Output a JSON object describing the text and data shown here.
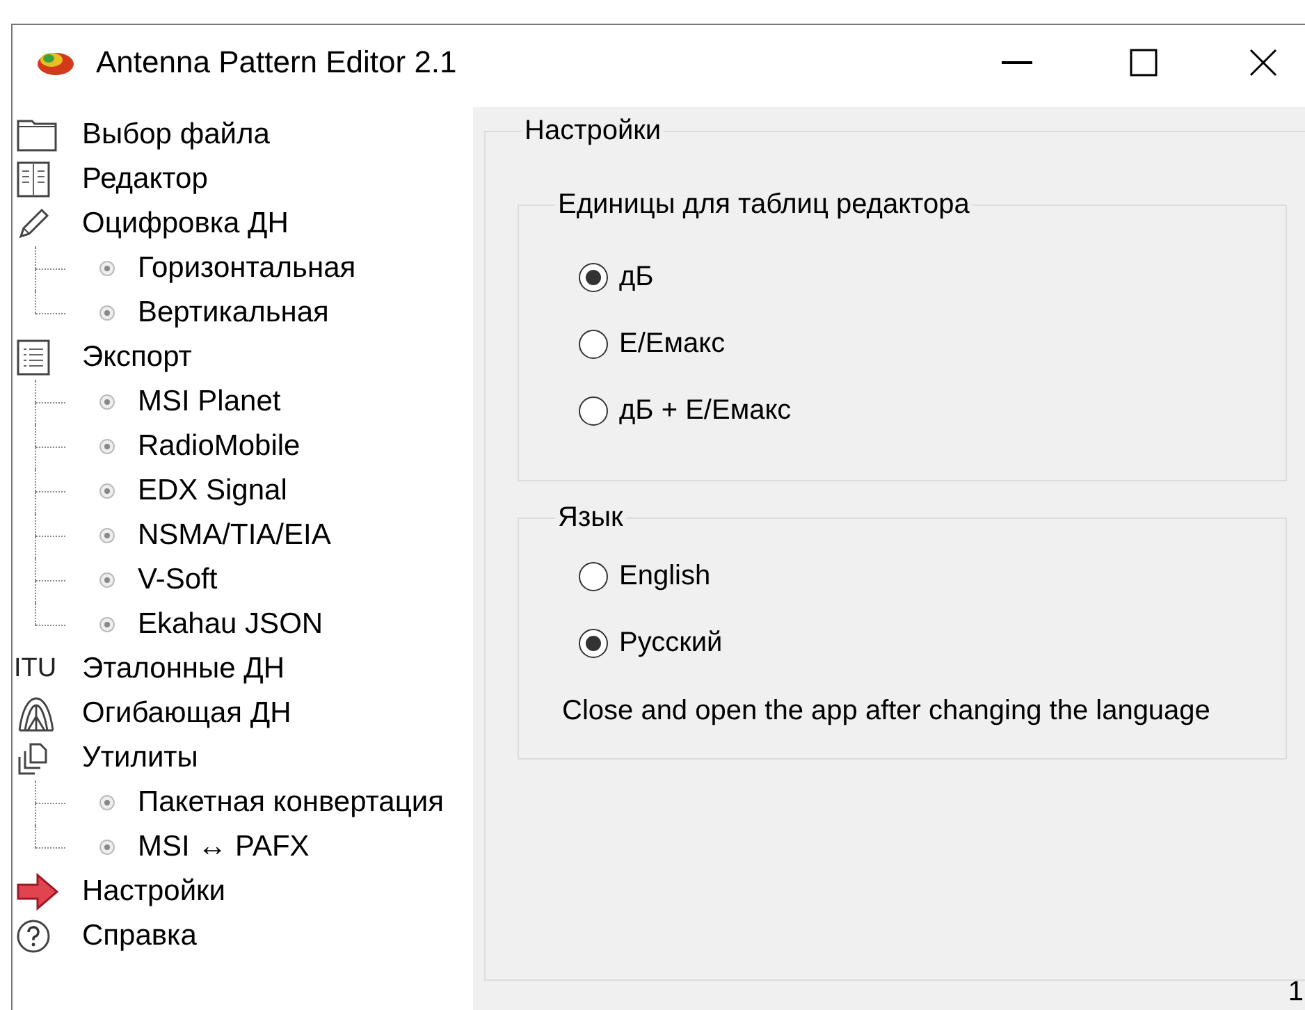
{
  "window": {
    "title": "Antenna Pattern Editor 2.1"
  },
  "sidebar": {
    "items": [
      {
        "kind": "folder",
        "label": "Выбор файла"
      },
      {
        "kind": "book",
        "label": "Редактор"
      },
      {
        "kind": "pencil",
        "label": "Оцифровка ДН",
        "children": [
          {
            "label": "Горизонтальная"
          },
          {
            "label": "Вертикальная"
          }
        ]
      },
      {
        "kind": "list",
        "label": "Экспорт",
        "children": [
          {
            "label": "MSI Planet"
          },
          {
            "label": "RadioMobile"
          },
          {
            "label": "EDX Signal"
          },
          {
            "label": "NSMA/TIA/EIA"
          },
          {
            "label": "V-Soft"
          },
          {
            "label": "Ekahau JSON"
          }
        ]
      },
      {
        "kind": "text",
        "icon_text": "ITU",
        "label": "Эталонные ДН"
      },
      {
        "kind": "envelope",
        "label": "Огибающая ДН"
      },
      {
        "kind": "utilities",
        "label": "Утилиты",
        "children": [
          {
            "label": "Пакетная конвертация"
          },
          {
            "label": "MSI ↔ PAFX"
          }
        ]
      },
      {
        "kind": "arrow",
        "label": "Настройки"
      },
      {
        "kind": "help",
        "label": "Справка"
      }
    ]
  },
  "settings": {
    "title": "Настройки",
    "groups": [
      {
        "title": "Единицы для таблиц редактора",
        "options": [
          {
            "label": "дБ",
            "selected": true
          },
          {
            "label": "Е/Емакс",
            "selected": false
          },
          {
            "label": "дБ + Е/Емакс",
            "selected": false
          }
        ]
      },
      {
        "title": "Язык",
        "options": [
          {
            "label": "English",
            "selected": false
          },
          {
            "label": "Русский",
            "selected": true
          }
        ],
        "note": "Close and open the app after changing the language"
      }
    ]
  },
  "corner_text": "1"
}
